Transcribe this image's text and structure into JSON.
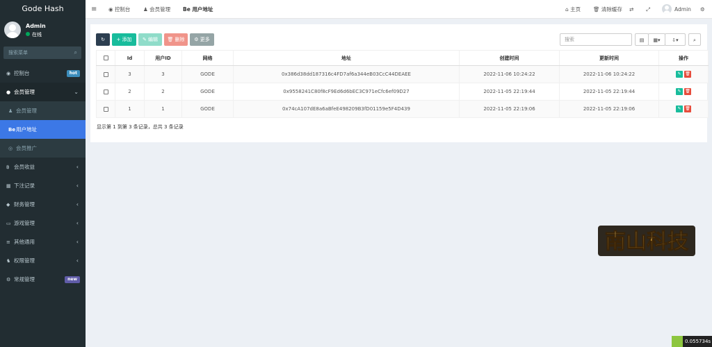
{
  "sidebar": {
    "brand": "Gode Hash",
    "user_name": "Admin",
    "user_status": "在线",
    "search_placeholder": "搜索菜单",
    "items": [
      {
        "icon": "dashboard-icon",
        "glyph": "◉",
        "label": "控制台",
        "badge": "hot",
        "badge_color": "#3c8dbc"
      },
      {
        "icon": "user-icon",
        "glyph": "●",
        "label": "会员管理",
        "arrow": "⌄"
      },
      {
        "icon": "user-icon",
        "glyph": "♟",
        "label": "会员管理"
      },
      {
        "icon": "bitcoin-icon",
        "glyph": "Be",
        "label": "用户地址"
      },
      {
        "icon": "eye-icon",
        "glyph": "◎",
        "label": "会员推广"
      },
      {
        "icon": "bitcoin-icon",
        "glyph": "฿",
        "label": "会员收益",
        "arrow": "‹"
      },
      {
        "icon": "calendar-icon",
        "glyph": "▦",
        "label": "下注记录",
        "arrow": "‹"
      },
      {
        "icon": "diamond-icon",
        "glyph": "◆",
        "label": "财务管理",
        "arrow": "‹"
      },
      {
        "icon": "gamepad-icon",
        "glyph": "▭",
        "label": "游戏管理",
        "arrow": "‹"
      },
      {
        "icon": "list-icon",
        "glyph": "≡",
        "label": "其他通用",
        "arrow": "‹"
      },
      {
        "icon": "users-icon",
        "glyph": "♞",
        "label": "权限管理",
        "arrow": "‹"
      },
      {
        "icon": "cogs-icon",
        "glyph": "⚙",
        "label": "常规管理",
        "badge": "new",
        "badge_color": "#605ca8"
      }
    ]
  },
  "header": {
    "menu_toggle": "≡",
    "tabs": [
      {
        "glyph": "◉",
        "label": "控制台"
      },
      {
        "glyph": "♟",
        "label": "会员管理"
      },
      {
        "glyph": "Be",
        "label": "用户地址"
      }
    ],
    "home_label": "主页",
    "clear_cache_label": "清除缓存",
    "user_name": "Admin"
  },
  "toolbar": {
    "refresh_glyph": "↻",
    "add_label": "+ 添加",
    "edit_label": "✎ 编辑",
    "delete_label": "🗑 删除",
    "more_label": "⚙ 更多",
    "search_placeholder": "搜索",
    "colors": {
      "refresh": "#2c3e50",
      "add": "#18bc9c",
      "edit": "#8fdcc9",
      "delete": "#f0948a",
      "more": "#95a5a6"
    }
  },
  "table": {
    "headers": [
      "",
      "Id",
      "用户ID",
      "网络",
      "地址",
      "创建时间",
      "更新时间",
      "操作"
    ],
    "rows": [
      {
        "id": "3",
        "user_id": "3",
        "network": "GODE",
        "address": "0x386d38dd187316c4FD7af6a344eB03CcC44DEAEE",
        "created": "2022-11-06 10:24:22",
        "updated": "2022-11-06 10:24:22"
      },
      {
        "id": "2",
        "user_id": "2",
        "network": "GODE",
        "address": "0x9558241C80f8cF9Ed6d6bEC3C971eCfc6ef09D27",
        "created": "2022-11-05 22:19:44",
        "updated": "2022-11-05 22:19:44"
      },
      {
        "id": "1",
        "user_id": "1",
        "network": "GODE",
        "address": "0x74cA107dE8a6aBfeE498209B3fD01159e5F4D439",
        "created": "2022-11-05 22:19:06",
        "updated": "2022-11-05 22:19:06"
      }
    ],
    "summary": "显示第 1 到第 3 条记录，总共 3 条记录"
  },
  "watermark": "南山科技",
  "timer": "0.055734s"
}
